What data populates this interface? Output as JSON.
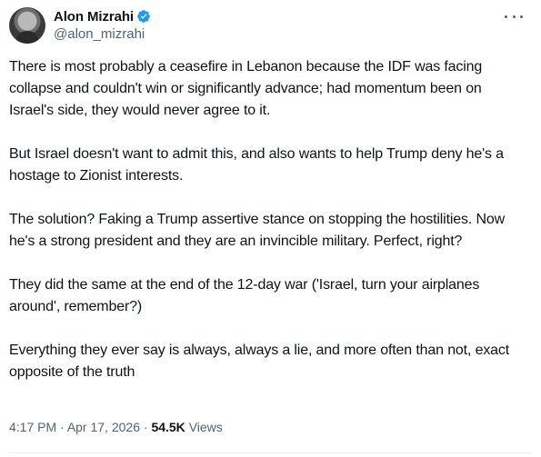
{
  "author": {
    "display_name": "Alon Mizrahi",
    "handle": "@alon_mizrahi",
    "verified": true,
    "verified_color": "#1d9bf0"
  },
  "more_icon": "more-horizontal-icon",
  "post": {
    "paragraphs": [
      "There is most probably a ceasefire in Lebanon because the IDF was facing collapse and couldn't win or significantly advance; had momentum been on Israel's side, they would never agree to it.",
      "But Israel doesn't want to admit this, and also wants to help Trump deny he's a hostage to Zionist interests.",
      "The solution? Faking a Trump assertive stance on stopping the hostilities. Now he's a strong president and they are an invincible military. Perfect, right?",
      "They did the same at the end of the 12-day war ('Israel, turn your airplanes around', remember?)",
      "Everything they ever say is always, always a lie, and more often than not, exact opposite of the truth"
    ]
  },
  "meta": {
    "time": "4:17 PM",
    "separator": " · ",
    "date": "Apr 17, 2026",
    "views_count": "54.5K",
    "views_label": "Views"
  }
}
